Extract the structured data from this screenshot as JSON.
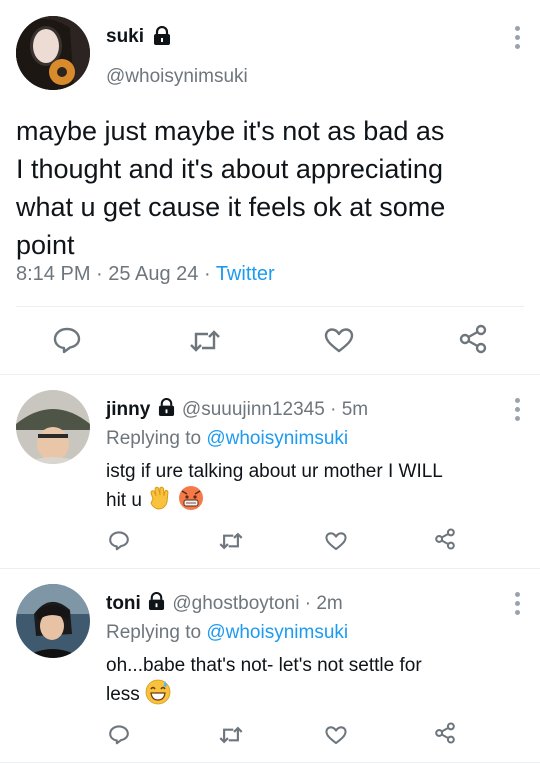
{
  "main_tweet": {
    "name": "suki",
    "handle": "@whoisynimsuki",
    "text_lines": [
      "maybe just maybe it's not as bad as",
      "I thought and it's about appreciating",
      "what u get cause it feels ok at some",
      "point"
    ],
    "time": "8:14 PM",
    "date": "25 Aug 24",
    "source": "Twitter"
  },
  "replies": [
    {
      "name": "jinny",
      "handle": "@suuujinn12345",
      "age": "5m",
      "replying_prefix": "Replying to",
      "replying_handle": "@whoisynimsuki",
      "text_line1": "istg if ure talking about ur mother I WILL",
      "text_line2": "hit u"
    },
    {
      "name": "toni",
      "handle": "@ghostboytoni",
      "age": "2m",
      "replying_prefix": "Replying to",
      "replying_handle": "@whoisynimsuki",
      "text_line1": "oh...babe that's not- let's not settle for",
      "text_line2": "less"
    }
  ],
  "separators": {
    "dot": "·"
  },
  "colors": {
    "link": "#1d9bf0",
    "secondary": "#6e767d",
    "icon": "#6e767d",
    "divider": "#eceff1"
  }
}
